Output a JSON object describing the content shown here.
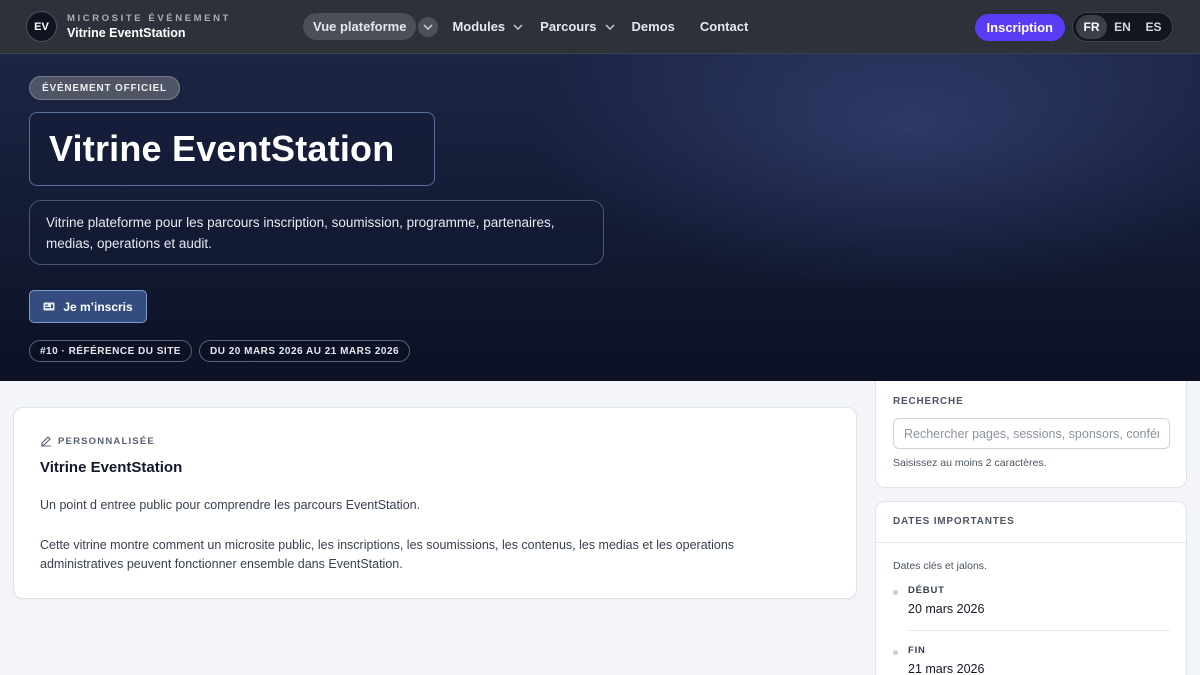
{
  "brand": {
    "logo": "EV",
    "kicker": "MICROSITE ÉVÉNEMENT",
    "name": "Vitrine EventStation"
  },
  "nav": {
    "items": [
      {
        "label": "Vue plateforme",
        "active": true,
        "has_menu": true
      },
      {
        "label": "Modules",
        "has_menu": true
      },
      {
        "label": "Parcours",
        "has_menu": true
      },
      {
        "label": "Demos"
      },
      {
        "label": "Contact"
      }
    ],
    "cta": "Inscription",
    "languages": [
      {
        "code": "FR",
        "active": true
      },
      {
        "code": "EN"
      },
      {
        "code": "ES"
      }
    ]
  },
  "hero": {
    "badge": "ÉVÉNEMENT OFFICIEL",
    "title": "Vitrine EventStation",
    "description": "Vitrine plateforme pour les parcours inscription, soumission, programme, partenaires, medias, operations et audit.",
    "button": {
      "label": "Je m’inscris",
      "icon": "ticket-icon"
    },
    "chips": [
      "#10 · RÉFÉRENCE DU SITE",
      "DU 20 MARS 2026 AU 21 MARS 2026"
    ]
  },
  "main": {
    "kicker": "PERSONNALISÉE",
    "kicker_icon": "edit-icon",
    "title": "Vitrine EventStation",
    "paragraph1": "Un point d entree public pour comprendre les parcours EventStation.",
    "paragraph2": "Cette vitrine montre comment un microsite public, les inscriptions, les soumissions, les contenus, les medias et les operations administratives peuvent fonctionner ensemble dans EventStation."
  },
  "search": {
    "label": "RECHERCHE",
    "placeholder": "Rechercher pages, sessions, sponsors, conférences",
    "help": "Saisissez au moins 2 caractères."
  },
  "dates": {
    "label": "DATES IMPORTANTES",
    "subtitle": "Dates clés et jalons.",
    "items": [
      {
        "label": "DÉBUT",
        "value": "20 mars 2026"
      },
      {
        "label": "FIN",
        "value": "21 mars 2026"
      }
    ]
  },
  "colors": {
    "accent": "#5b3cf5",
    "nav_bg": "#2d3139",
    "hero_bg": "#141b35",
    "hero_button": "#354d7e"
  }
}
